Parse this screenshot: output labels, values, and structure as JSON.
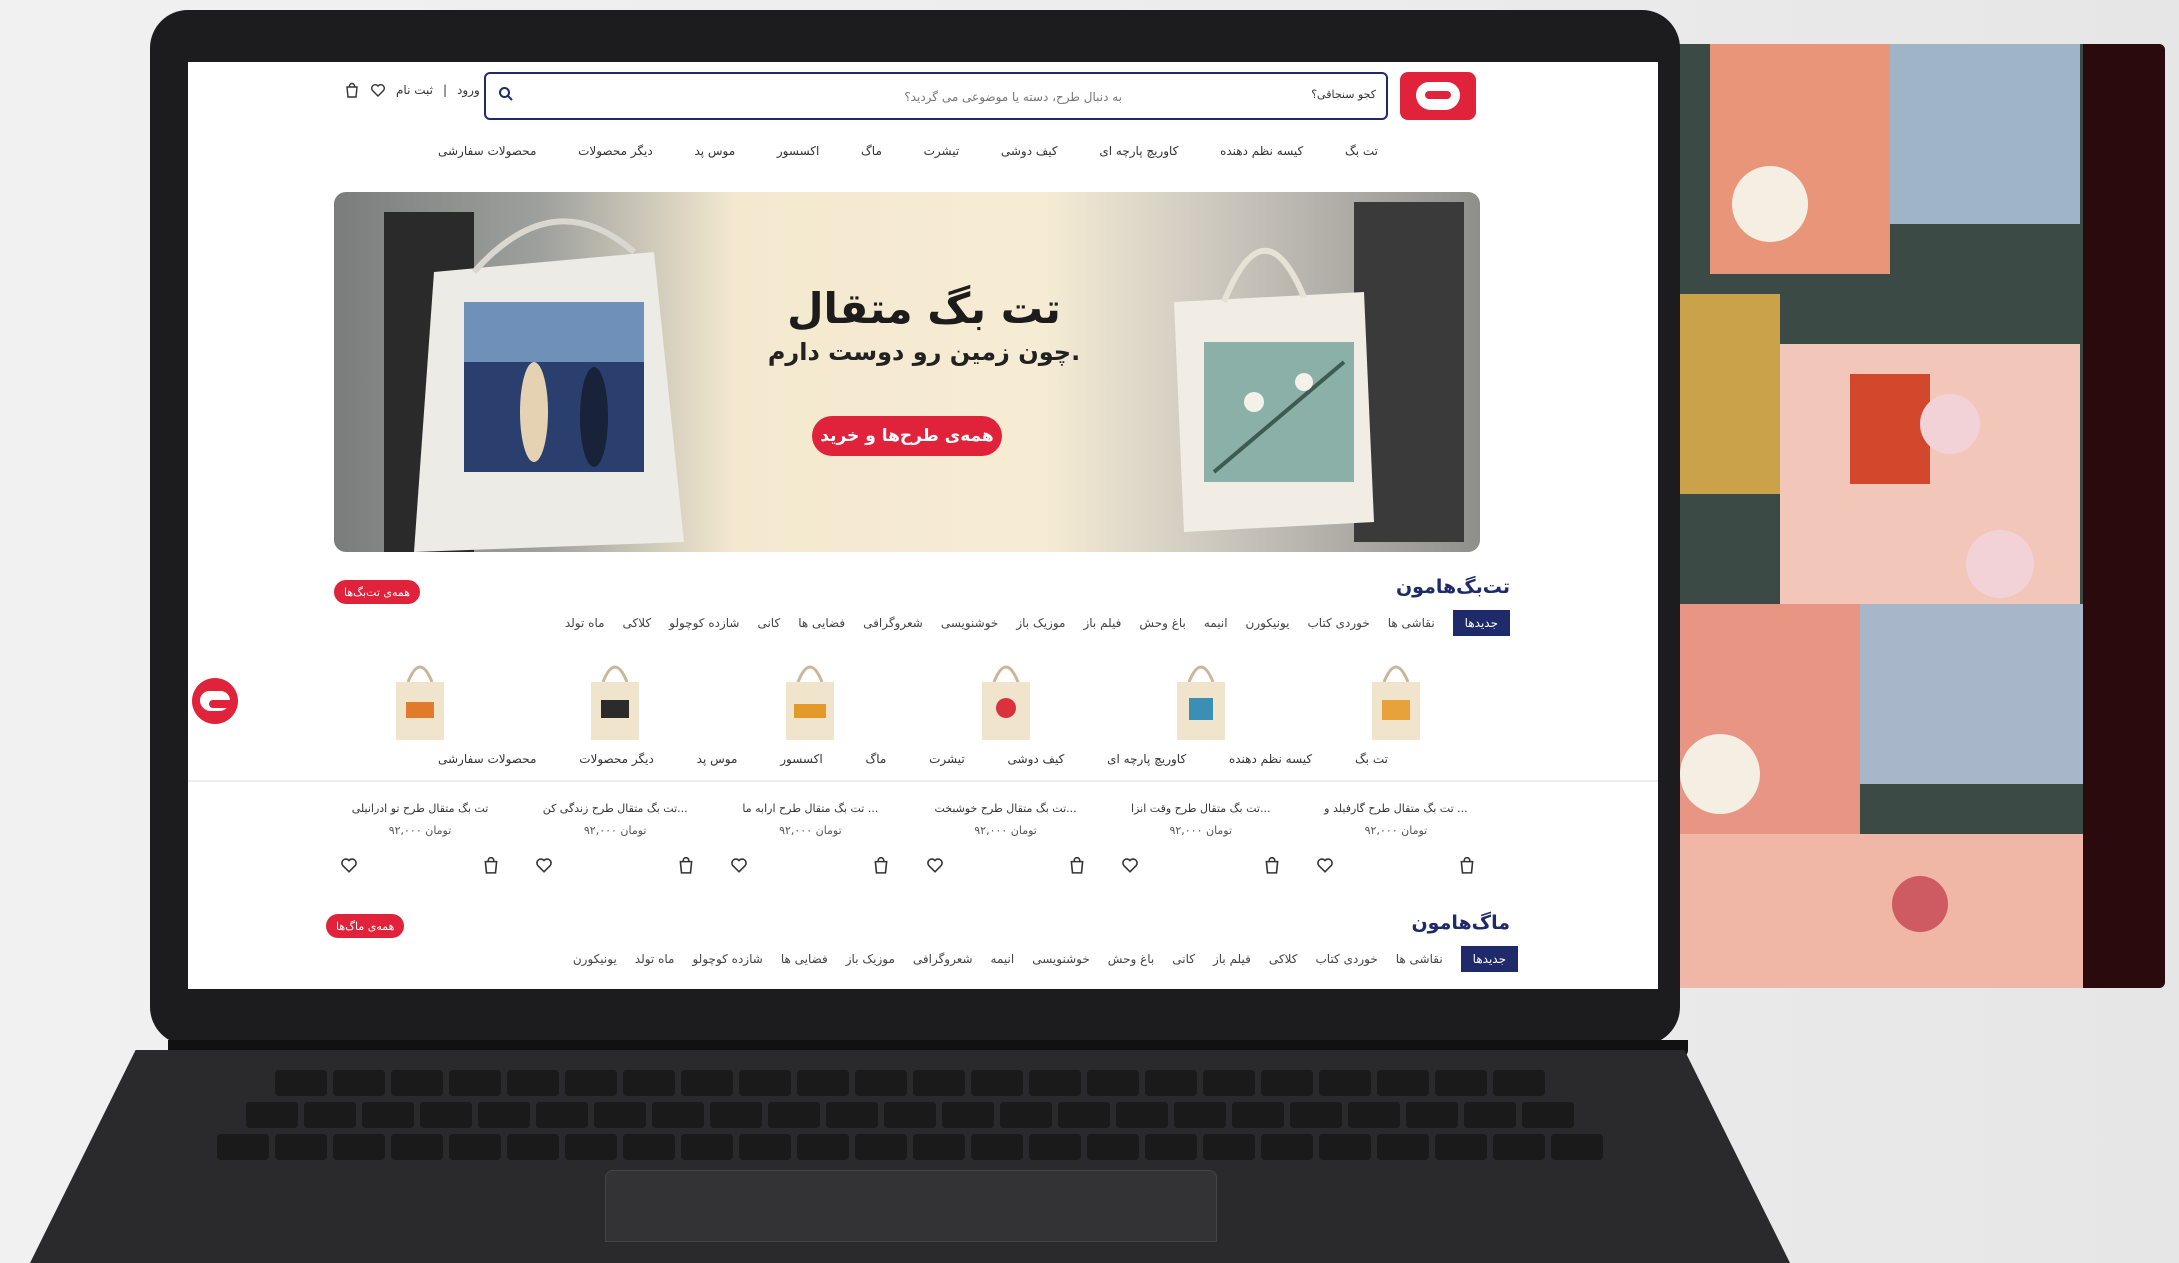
{
  "header": {
    "login_label": "ورود",
    "register_label": "ثبت نام",
    "search_placeholder": "به دنبال طرح، دسته یا موضوعی می گردید؟",
    "search_hint": "کجو سنجاقی؟"
  },
  "nav": {
    "items": [
      "تت بگ",
      "کیسه نظم دهنده",
      "کاوریچ پارچه ای",
      "کیف دوشی",
      "تیشرت",
      "ماگ",
      "اکسسور",
      "موس پد",
      "دیگر محصولات",
      "محصولات سفارشی"
    ]
  },
  "hero": {
    "title": "تت بگ متقال",
    "subtitle": "چون زمین رو دوست دارم.",
    "cta": "همه‌ی طرح‌ها و خرید"
  },
  "totebags": {
    "title": "تت‌بگ‌هامون",
    "all_button": "همه‌ی تت‌بگ‌ها",
    "tabs": [
      "جدیدها",
      "نقاشی ها",
      "خوردی کتاب",
      "یونیکورن",
      "انیمه",
      "باغ وحش",
      "فیلم باز",
      "موزیک باز",
      "خوشنویسی",
      "شعروگرافی",
      "فضایی ها",
      "کانی",
      "شازده کوچولو",
      "کلاکی",
      "ماه تولد"
    ],
    "product_card_count": 6
  },
  "sub_nav": {
    "items": [
      "تت بگ",
      "کیسه نظم دهنده",
      "کاوریچ پارچه ای",
      "کیف دوشی",
      "تیشرت",
      "ماگ",
      "اکسسور",
      "موس پد",
      "دیگر محصولات",
      "محصولات سفارشی"
    ]
  },
  "product_cards": [
    {
      "title": "تت بگ متقال طرح گارفیلد و ...",
      "price": "۹۲,۰۰۰ تومان"
    },
    {
      "title": "تت بگ متقال طرح وقت انزا...",
      "price": "۹۲,۰۰۰ تومان"
    },
    {
      "title": "تت بگ متقال طرح خوشبخت...",
      "price": "۹۲,۰۰۰ تومان"
    },
    {
      "title": "تت بگ متقال طرح ارابه ما ...",
      "price": "۹۲,۰۰۰ تومان"
    },
    {
      "title": "تت بگ متقال طرح زندگی کن...",
      "price": "۹۲,۰۰۰ تومان"
    },
    {
      "title": "تت بگ متقال طرح تو ادرانیلی",
      "price": "۹۲,۰۰۰ تومان"
    }
  ],
  "mugs": {
    "title": "ماگ‌هامون",
    "all_button": "همه‌ی ماگ‌ها",
    "tabs": [
      "جدیدها",
      "نقاشی ها",
      "خوردی کتاب",
      "کلاکی",
      "فیلم باز",
      "کانی",
      "باغ وحش",
      "خوشنویسی",
      "انیمه",
      "شعروگرافی",
      "موزیک باز",
      "فضایی ها",
      "شازده کوچولو",
      "ماه تولد",
      "یونیکورن"
    ]
  },
  "colors": {
    "brand_red": "#e0233b",
    "navy": "#1f2a6b"
  },
  "icons": {
    "logo": "brand-mouth-logo",
    "search": "search-icon",
    "cart": "bag-icon",
    "wishlist": "heart-icon"
  }
}
